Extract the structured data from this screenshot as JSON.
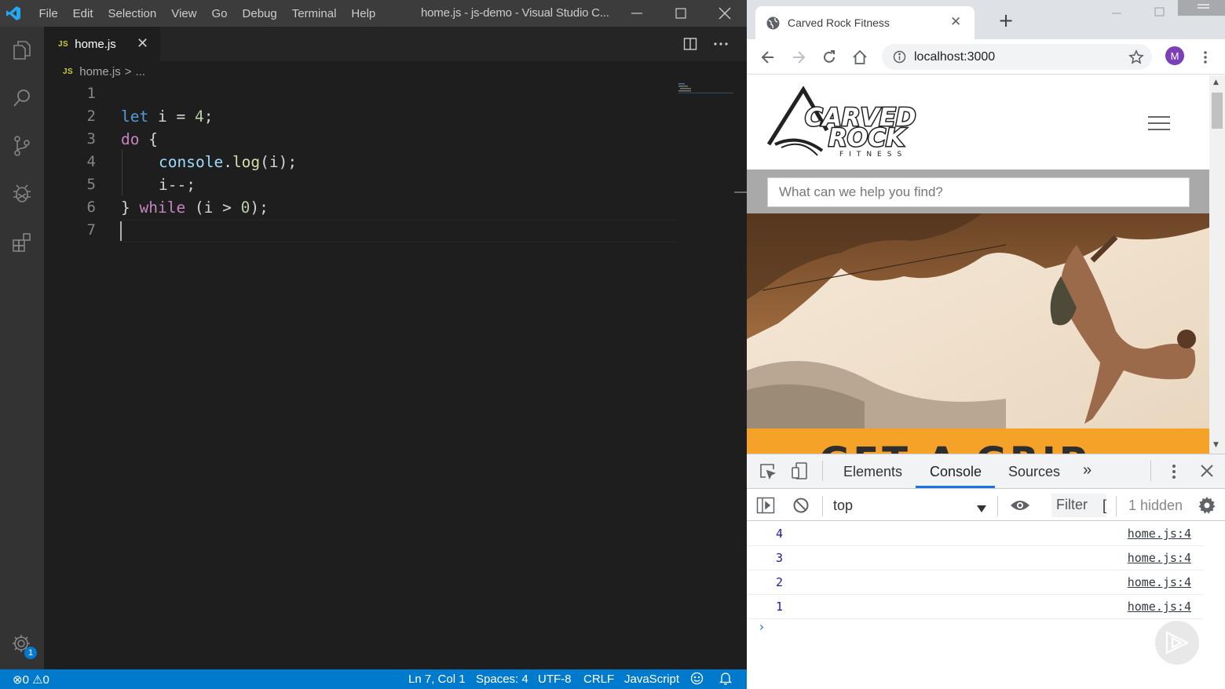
{
  "vscode": {
    "menu": [
      "File",
      "Edit",
      "Selection",
      "View",
      "Go",
      "Debug",
      "Terminal",
      "Help"
    ],
    "window_title": "home.js - js-demo - Visual Studio C...",
    "tab": {
      "icon_label": "JS",
      "label": "home.js"
    },
    "breadcrumb": {
      "file": "home.js",
      "sep": ">",
      "more": "..."
    },
    "line_numbers": [
      "1",
      "2",
      "3",
      "4",
      "5",
      "6",
      "7"
    ],
    "code": {
      "l2": {
        "kw": "let",
        "rest": " i = ",
        "num": "4",
        "end": ";"
      },
      "l3": {
        "kw": "do",
        "rest": " {"
      },
      "l4": {
        "obj": "console",
        "dot": ".",
        "fn": "log",
        "rest": "(i);"
      },
      "l5": {
        "rest": "i--;"
      },
      "l6": {
        "open": "} ",
        "kw": "while",
        "rest": " (i > ",
        "num": "0",
        "end": ");"
      }
    },
    "status": {
      "errors": "0",
      "warnings": "0",
      "position": "Ln 7, Col 1",
      "spaces": "Spaces: 4",
      "encoding": "UTF-8",
      "eol": "CRLF",
      "language": "JavaScript"
    },
    "settings_badge": "1",
    "colors": {
      "statusbar": "#007acc",
      "editor_bg": "#1e1e1e",
      "activity_bg": "#333333"
    }
  },
  "chrome": {
    "tab_title": "Carved Rock Fitness",
    "url": "localhost:3000",
    "avatar": "M",
    "page": {
      "logo_line1": "CARVED",
      "logo_line2": "ROCK",
      "logo_line3": "FITNESS",
      "search_placeholder": "What can we help you find?",
      "banner_text": "GET A GRIP"
    },
    "devtools": {
      "tabs": [
        "Elements",
        "Console",
        "Sources"
      ],
      "active_tab": "Console",
      "context": "top",
      "filter": "Filter",
      "hidden": "1 hidden",
      "logs": [
        {
          "value": "4",
          "source": "home.js:4"
        },
        {
          "value": "3",
          "source": "home.js:4"
        },
        {
          "value": "2",
          "source": "home.js:4"
        },
        {
          "value": "1",
          "source": "home.js:4"
        }
      ]
    }
  }
}
